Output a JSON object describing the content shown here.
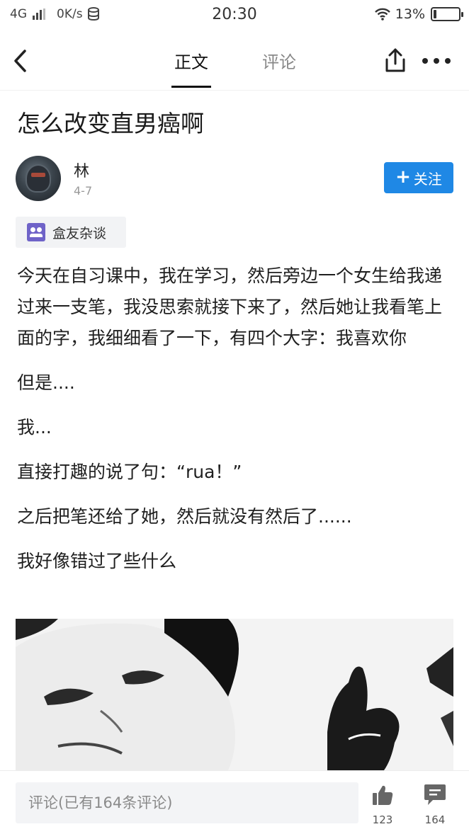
{
  "status_bar": {
    "network": "4G",
    "speed": "0K/s",
    "time": "20:30",
    "battery": "13%",
    "battery_level": 0.13
  },
  "nav": {
    "tabs": [
      {
        "label": "正文",
        "active": true
      },
      {
        "label": "评论",
        "active": false
      }
    ],
    "icons": [
      "back-icon",
      "share-icon",
      "more-icon"
    ]
  },
  "article": {
    "title": "怎么改变直男癌啊",
    "author": "林",
    "date": "4-7",
    "follow_label": "关注",
    "tag": "盒友杂谈",
    "paragraphs": [
      "今天在自习课中，我在学习，然后旁边一个女生给我递过来一支笔，我没思索就接下来了，然后她让我看笔上面的字，我细细看了一下，有四个大字：我喜欢你",
      "但是....",
      "我...",
      "直接打趣的说了句：“rua！”",
      "之后把笔还给了她，然后就没有然后了......",
      "我好像错过了些什么"
    ]
  },
  "bottom_bar": {
    "comment_placeholder": "评论(已有164条评论)",
    "likes": "123",
    "comments": "164"
  },
  "colors": {
    "accent": "#1f88e5",
    "tag_icon": "#6f63c8"
  }
}
